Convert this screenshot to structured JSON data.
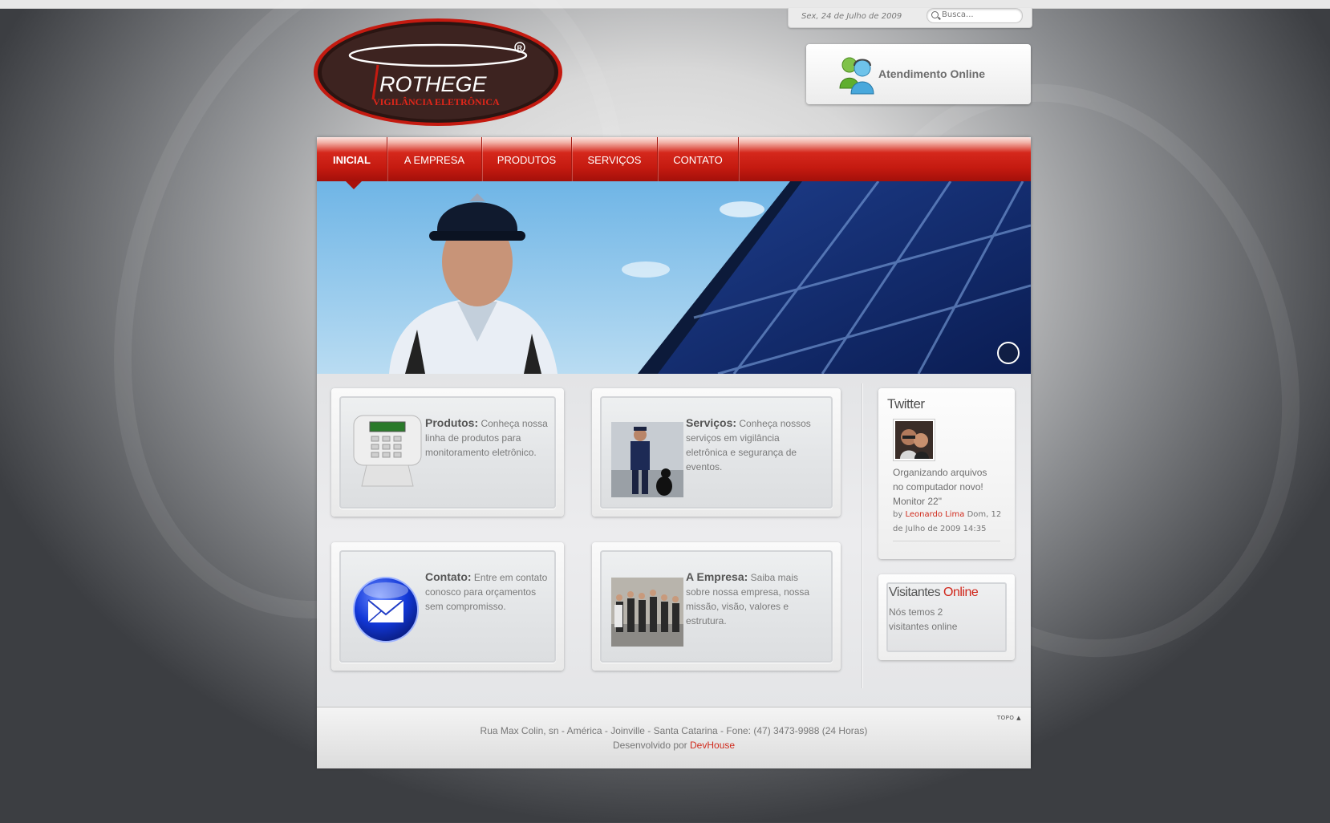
{
  "header": {
    "date": "Sex, 24 de Julho de 2009",
    "search_placeholder": "Busca...",
    "logo_text": "ROTHEGE",
    "logo_subtitle": "VIGILÂNCIA ELETRÔNICA",
    "atendimento_label": "Atendimento Online"
  },
  "nav": {
    "items": [
      {
        "label": "INICIAL"
      },
      {
        "label": "A EMPRESA"
      },
      {
        "label": "PRODUTOS"
      },
      {
        "label": "SERVIÇOS"
      },
      {
        "label": "CONTATO"
      }
    ]
  },
  "cards": [
    {
      "title": "Produtos:",
      "text": "Conheça nossa linha de produtos para monitoramento eletrônico.",
      "icon": "alarm-keypad"
    },
    {
      "title": "Serviços:",
      "text": "Conheça nossos serviços em vigilância eletrônica e segurança de eventos.",
      "icon": "security-guard-photo"
    },
    {
      "title": "Contato:",
      "text": "Entre em contato conosco para orçamentos sem compromisso.",
      "icon": "envelope-icon"
    },
    {
      "title": "A Empresa:",
      "text": "Saiba mais sobre nossa empresa, nossa missão, visão, valores e estrutura.",
      "icon": "team-photo"
    }
  ],
  "twitter": {
    "title": "Twitter",
    "message": "Organizando arquivos no computador novo! Monitor 22\"",
    "by": "by",
    "author": "Leonardo Lima",
    "date": "Dom, 12 de Julho de 2009 14:35"
  },
  "visitors": {
    "title_part1": "Visitantes",
    "title_part2": "Online",
    "text": "Nós temos 2 visitantes online"
  },
  "footer": {
    "topo": "TOPO",
    "address": "Rua Max Colin, sn - América - Joinville - Santa Catarina - Fone: (47) 3473-9988 (24 Horas)",
    "dev_prefix": "Desenvolvido por",
    "dev_link": "DevHouse"
  },
  "colors": {
    "accent_red": "#c41a10",
    "link_red": "#d02a1c"
  }
}
